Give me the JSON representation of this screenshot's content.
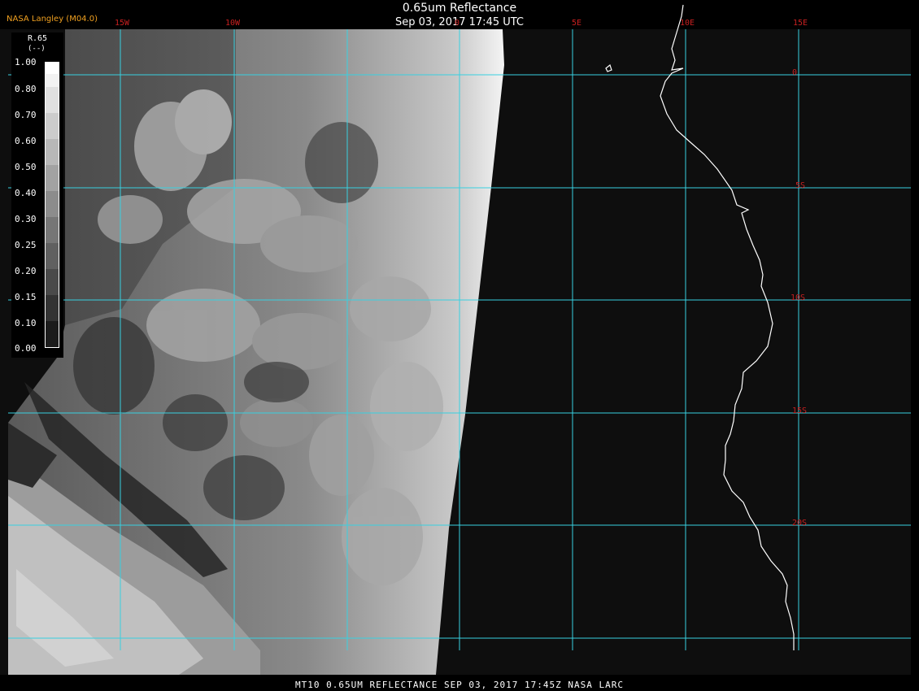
{
  "header": {
    "title": "0.65um Reflectance",
    "subtitle": "Sep 03, 2017 17:45 UTC",
    "product": "NASA Langley (M04.0)"
  },
  "map": {
    "lon_labels": [
      "15W",
      "10W",
      "0",
      "5E",
      "10E",
      "15E"
    ],
    "lat_labels": [
      "0",
      "5S",
      "10S",
      "15S",
      "20S"
    ],
    "grid_color": "#38d0e0",
    "label_color": "#c82020",
    "coastline_color": "#ffffff"
  },
  "colorbar": {
    "variable": "R.65",
    "unit": "(--)",
    "ticks": [
      "1.00",
      "0.80",
      "0.70",
      "0.60",
      "0.50",
      "0.40",
      "0.30",
      "0.25",
      "0.20",
      "0.15",
      "0.10",
      "0.00"
    ]
  },
  "footer": "MT10  0.65UM REFLECTANCE   SEP 03, 2017 17:45Z   NASA LARC"
}
